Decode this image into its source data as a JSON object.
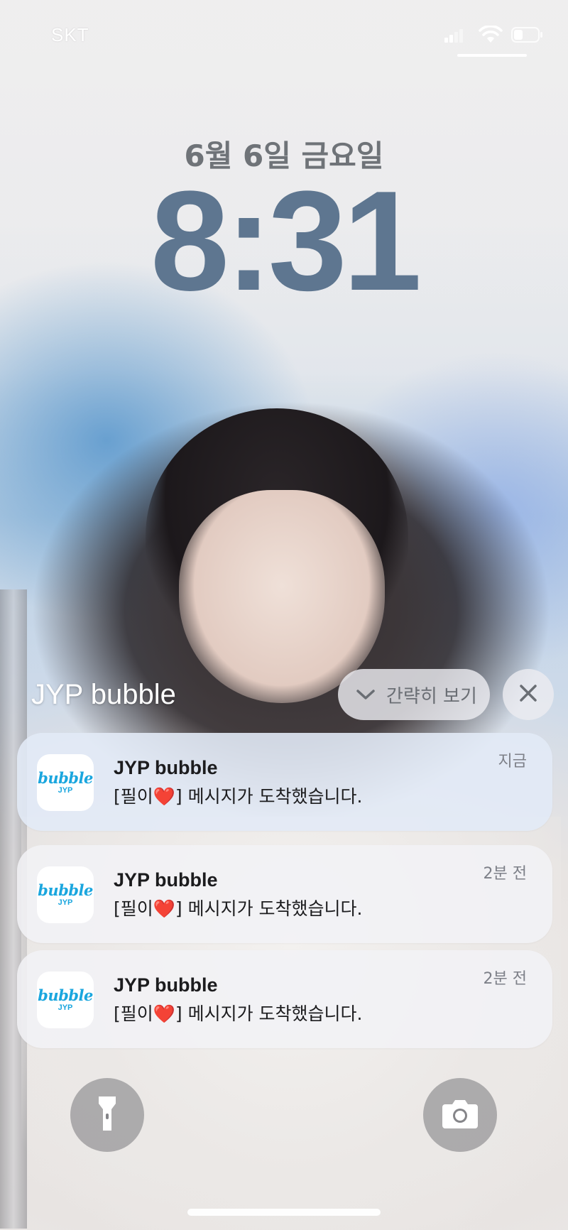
{
  "status_bar": {
    "carrier": "SKT",
    "icons": [
      "signal-icon",
      "wifi-icon",
      "battery-icon"
    ]
  },
  "lock_screen": {
    "date": "6월 6일 금요일",
    "time": "8:31"
  },
  "notification_group": {
    "app_name": "JYP bubble",
    "show_less_label": "간략히 보기",
    "icons": [
      "chevron-down-icon",
      "close-icon"
    ]
  },
  "notifications": [
    {
      "title": "JYP bubble",
      "body": "[필이❤️] 메시지가 도착했습니다.",
      "time": "지금"
    },
    {
      "title": "JYP bubble",
      "body": "[필이❤️] 메시지가 도착했습니다.",
      "time": "2분 전"
    },
    {
      "title": "JYP bubble",
      "body": "[필이❤️] 메시지가 도착했습니다.",
      "time": "2분 전"
    }
  ],
  "app_icon": {
    "word": "bubble",
    "sub": "JYP",
    "color": "#1aa6de"
  },
  "controls": {
    "icons": [
      "flashlight-icon",
      "camera-icon"
    ]
  }
}
